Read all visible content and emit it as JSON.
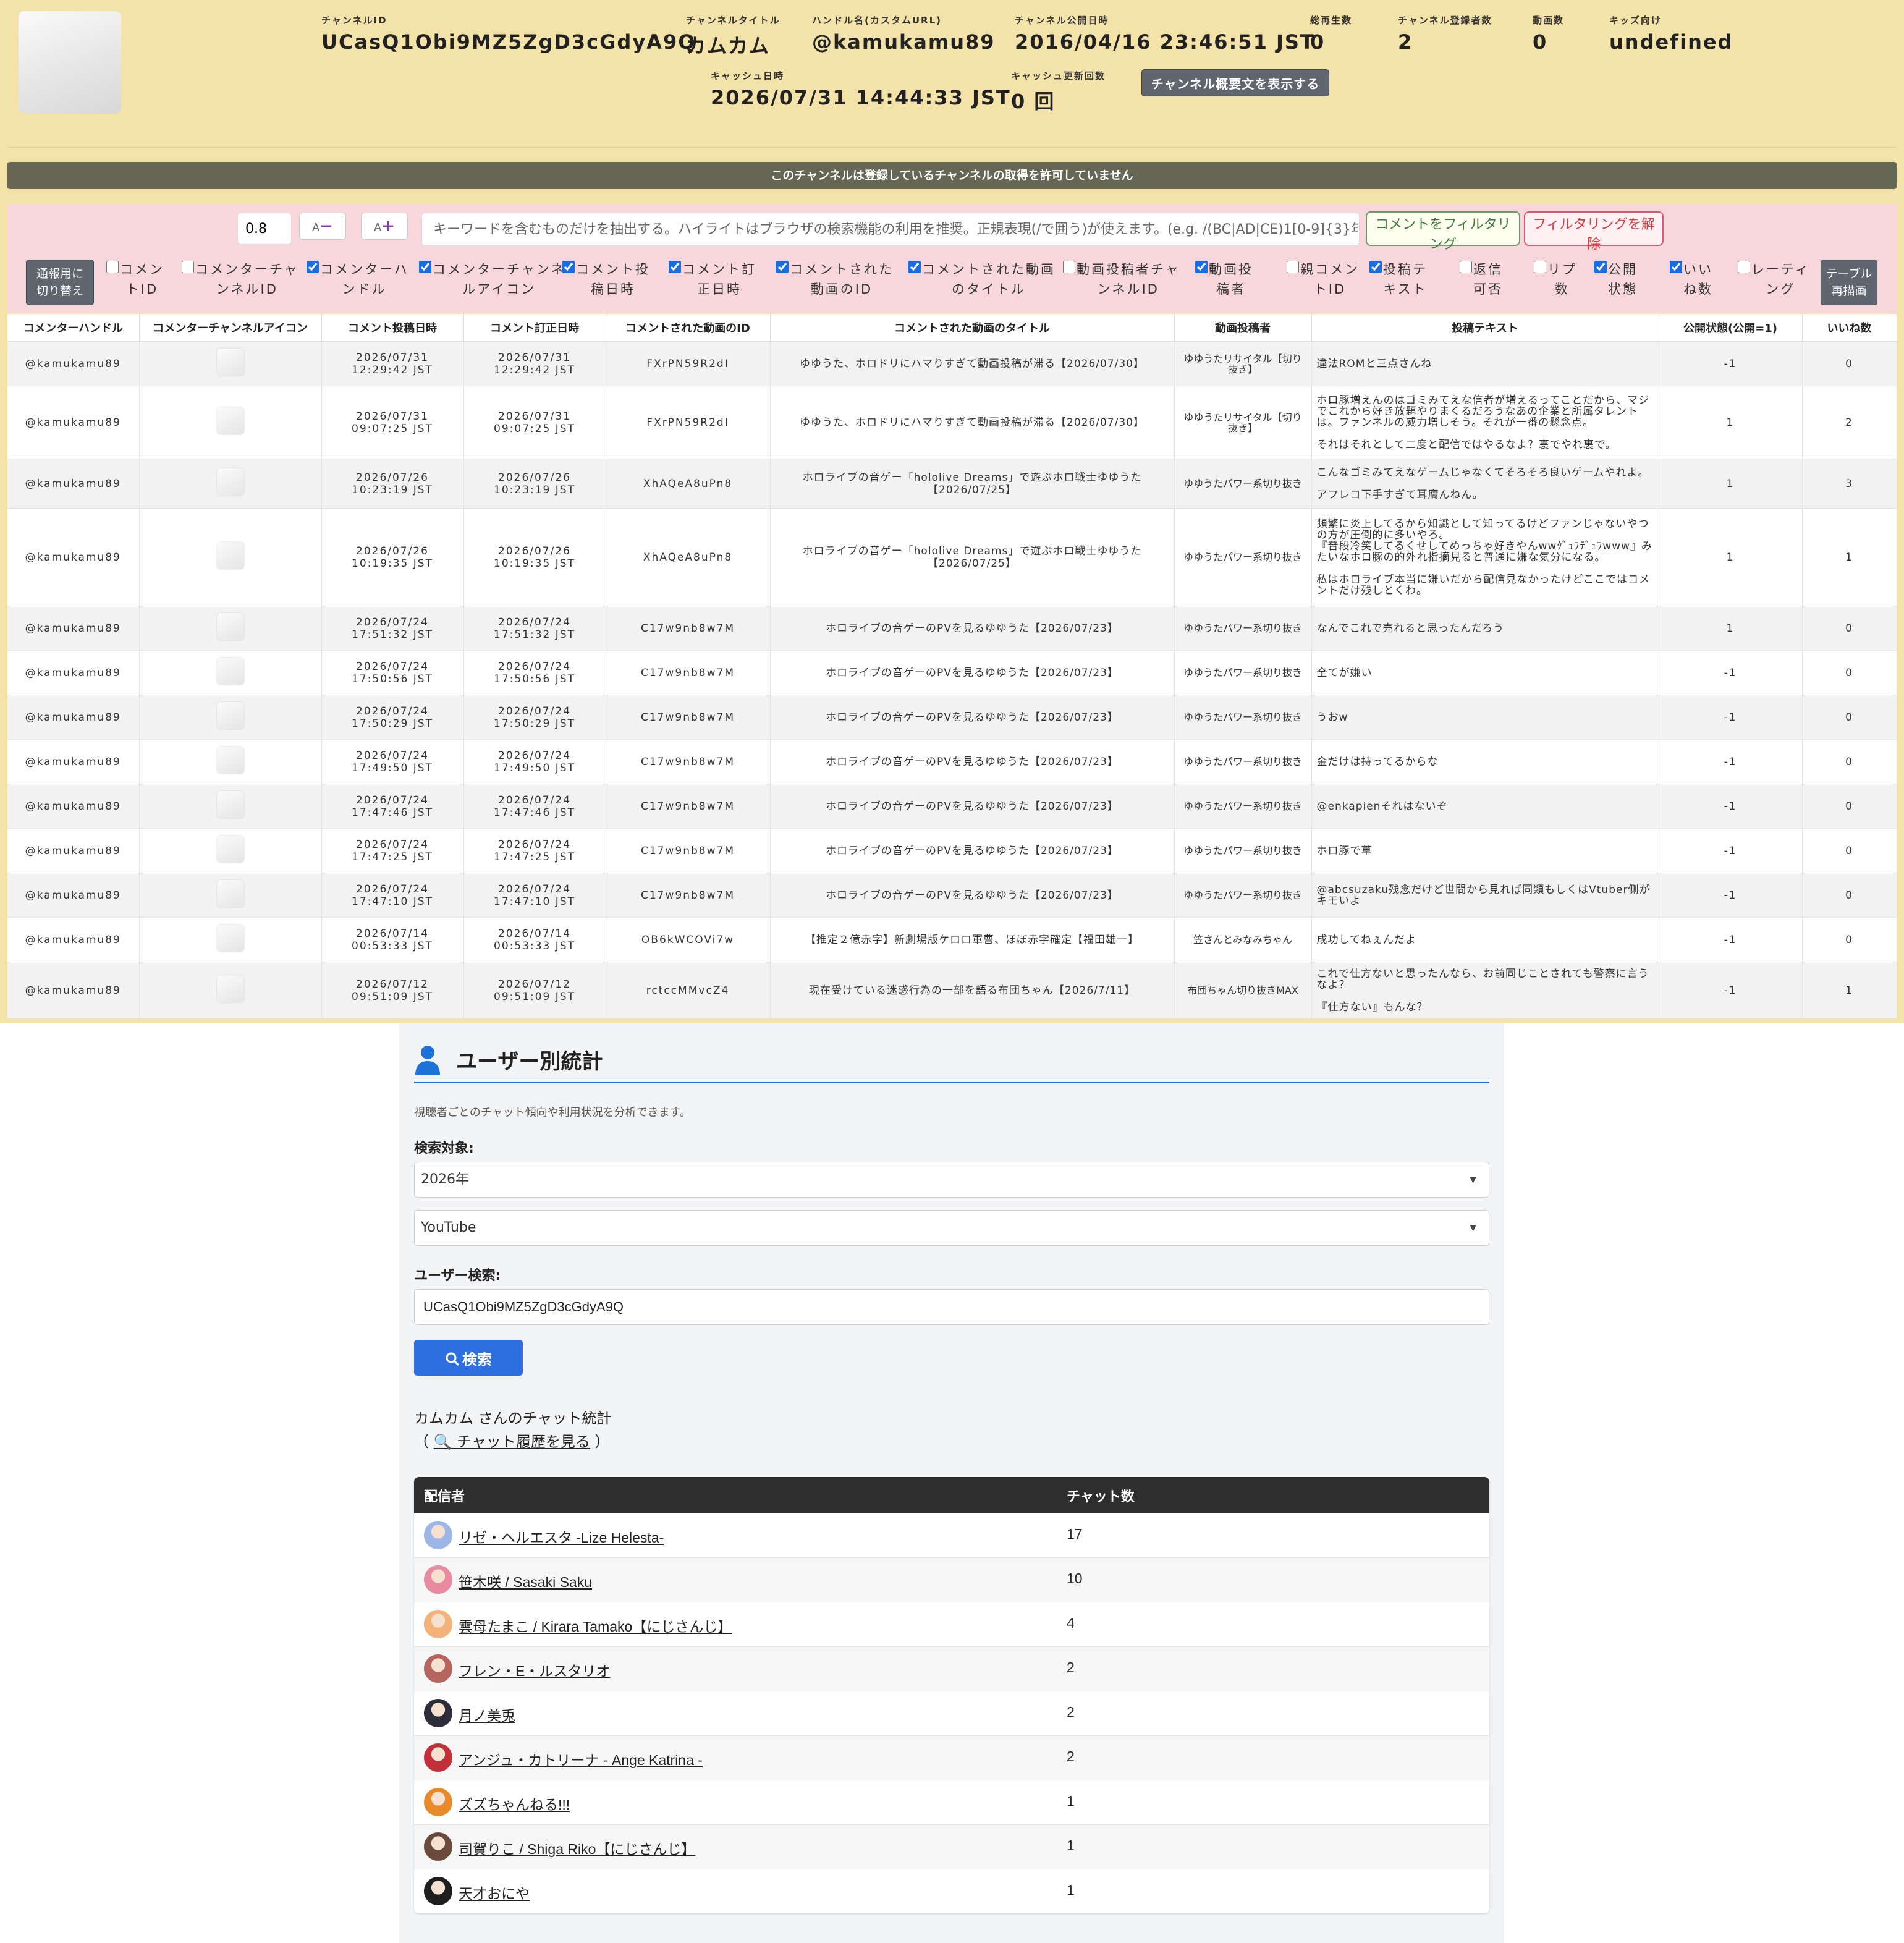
{
  "header": {
    "fields": [
      {
        "label": "チャンネルID",
        "value": "UCasQ1Obi9MZ5ZgD3cGdyA9Q"
      },
      {
        "label": "チャンネルタイトル",
        "value": "カムカム"
      },
      {
        "label": "ハンドル名(カスタムURL)",
        "value": "@kamukamu89"
      },
      {
        "label": "チャンネル公開日時",
        "value": "2016/04/16 23:46:51 JST"
      },
      {
        "label": "総再生数",
        "value": "0"
      },
      {
        "label": "チャンネル登録者数",
        "value": "2"
      },
      {
        "label": "動画数",
        "value": "0"
      },
      {
        "label": "キッズ向け",
        "value": "undefined"
      },
      {
        "label": "キャッシュ日時",
        "value": "2026/07/31 14:44:33 JST"
      },
      {
        "label": "キャッシュ更新回数",
        "value": "0 回"
      }
    ],
    "desc_button": "チャンネル概要文を表示する"
  },
  "banner": "このチャンネルは登録しているチャンネルの取得を許可していません",
  "filter": {
    "font_scale": "0.8",
    "decrease_label": "A",
    "increase_label": "A",
    "keyword_placeholder": "キーワードを含むものだけを抽出する。ハイライトはブラウザの検索機能の利用を推奨。正規表現(/で囲う)が使えます。(e.g. /(BC|AD|CE)1[0-9]{3}年生まれ/i )",
    "apply_label": "コメントをフィルタリング",
    "clear_label": "フィルタリングを解除",
    "switch_label": "通報用に\n切り替え",
    "redraw_label": "テーブル\n再描画",
    "columns": [
      {
        "label": "コメン\nトID",
        "checked": false
      },
      {
        "label": "コメンターチャ\nンネルID",
        "checked": false
      },
      {
        "label": "コメンターハ\nンドル",
        "checked": true
      },
      {
        "label": "コメンターチャンネ\nルアイコン",
        "checked": true
      },
      {
        "label": "コメント投\n稿日時",
        "checked": true
      },
      {
        "label": "コメント訂\n正日時",
        "checked": true
      },
      {
        "label": "コメントされた\n動画のID",
        "checked": true
      },
      {
        "label": "コメントされた動画\nのタイトル",
        "checked": true
      },
      {
        "label": "動画投稿者チャ\nンネルID",
        "checked": false
      },
      {
        "label": "動画投\n稿者",
        "checked": true
      },
      {
        "label": "親コメン\nトID",
        "checked": false
      },
      {
        "label": "投稿テ\nキスト",
        "checked": true
      },
      {
        "label": "返信\n可否",
        "checked": false
      },
      {
        "label": "リプ\n数",
        "checked": false
      },
      {
        "label": "公開\n状態",
        "checked": true
      },
      {
        "label": "いい\nね数",
        "checked": true
      },
      {
        "label": "レーティ\nング",
        "checked": false
      }
    ]
  },
  "table": {
    "headers": [
      "コメンターハンドル",
      "コメンターチャンネルアイコン",
      "コメント投稿日時",
      "コメント訂正日時",
      "コメントされた動画のID",
      "コメントされた動画のタイトル",
      "動画投稿者",
      "投稿テキスト",
      "公開状態(公開=1)",
      "いいね数"
    ],
    "rows": [
      {
        "handle": "@kamukamu89",
        "posted": "2026/07/31\n12:29:42 JST",
        "edited": "2026/07/31\n12:29:42 JST",
        "video_id": "FXrPN59R2dI",
        "title": "ゆゆうた、ホロドリにハマりすぎて動画投稿が滞る【2026/07/30】",
        "uploader": "ゆゆうたリサイタル【切り抜き】",
        "text": "違法ROMと三点さんね",
        "public": "-1",
        "likes": "0"
      },
      {
        "handle": "@kamukamu89",
        "posted": "2026/07/31\n09:07:25 JST",
        "edited": "2026/07/31\n09:07:25 JST",
        "video_id": "FXrPN59R2dI",
        "title": "ゆゆうた、ホロドリにハマりすぎて動画投稿が滞る【2026/07/30】",
        "uploader": "ゆゆうたリサイタル【切り抜き】",
        "text": "ホロ豚増えんのはゴミみてえな信者が増えるってことだから、マジでこれから好き放題やりまくるだろうなあの企業と所属タレントは。ファンネルの威力増しそう。それが一番の懸念点。\n\nそれはそれとして二度と配信ではやるなよ？裏でやれ裏で。",
        "public": "1",
        "likes": "2"
      },
      {
        "handle": "@kamukamu89",
        "posted": "2026/07/26\n10:23:19 JST",
        "edited": "2026/07/26\n10:23:19 JST",
        "video_id": "XhAQeA8uPn8",
        "title": "ホロライブの音ゲー「hololive Dreams」で遊ぶホロ戦士ゆゆうた【2026/07/25】",
        "uploader": "ゆゆうたパワー系切り抜き",
        "text": "こんなゴミみてえなゲームじゃなくてそろそろ良いゲームやれよ。\n\nアフレコ下手すぎて耳腐んねん。",
        "public": "1",
        "likes": "3"
      },
      {
        "handle": "@kamukamu89",
        "posted": "2026/07/26\n10:19:35 JST",
        "edited": "2026/07/26\n10:19:35 JST",
        "video_id": "XhAQeA8uPn8",
        "title": "ホロライブの音ゲー「hololive Dreams」で遊ぶホロ戦士ゆゆうた【2026/07/25】",
        "uploader": "ゆゆうたパワー系切り抜き",
        "text": "頻繁に炎上してるから知識として知ってるけどファンじゃないやつの方が圧倒的に多いやろ。\n『普段冷笑してるくせしてめっちゃ好きやんwwｸﾞｭﾌﾃﾞｭﾌwww』みたいなホロ豚の的外れ指摘見ると普通に嫌な気分になる。\n\n私はホロライブ本当に嫌いだから配信見なかったけどここではコメントだけ残しとくわ。",
        "public": "1",
        "likes": "1"
      },
      {
        "handle": "@kamukamu89",
        "posted": "2026/07/24\n17:51:32 JST",
        "edited": "2026/07/24\n17:51:32 JST",
        "video_id": "C17w9nb8w7M",
        "title": "ホロライブの音ゲーのPVを見るゆゆうた【2026/07/23】",
        "uploader": "ゆゆうたパワー系切り抜き",
        "text": "なんでこれで売れると思ったんだろう",
        "public": "1",
        "likes": "0"
      },
      {
        "handle": "@kamukamu89",
        "posted": "2026/07/24\n17:50:56 JST",
        "edited": "2026/07/24\n17:50:56 JST",
        "video_id": "C17w9nb8w7M",
        "title": "ホロライブの音ゲーのPVを見るゆゆうた【2026/07/23】",
        "uploader": "ゆゆうたパワー系切り抜き",
        "text": "全てが嫌い",
        "public": "-1",
        "likes": "0"
      },
      {
        "handle": "@kamukamu89",
        "posted": "2026/07/24\n17:50:29 JST",
        "edited": "2026/07/24\n17:50:29 JST",
        "video_id": "C17w9nb8w7M",
        "title": "ホロライブの音ゲーのPVを見るゆゆうた【2026/07/23】",
        "uploader": "ゆゆうたパワー系切り抜き",
        "text": "うおw",
        "public": "-1",
        "likes": "0"
      },
      {
        "handle": "@kamukamu89",
        "posted": "2026/07/24\n17:49:50 JST",
        "edited": "2026/07/24\n17:49:50 JST",
        "video_id": "C17w9nb8w7M",
        "title": "ホロライブの音ゲーのPVを見るゆゆうた【2026/07/23】",
        "uploader": "ゆゆうたパワー系切り抜き",
        "text": "金だけは持ってるからな",
        "public": "-1",
        "likes": "0"
      },
      {
        "handle": "@kamukamu89",
        "posted": "2026/07/24\n17:47:46 JST",
        "edited": "2026/07/24\n17:47:46 JST",
        "video_id": "C17w9nb8w7M",
        "title": "ホロライブの音ゲーのPVを見るゆゆうた【2026/07/23】",
        "uploader": "ゆゆうたパワー系切り抜き",
        "text": "@enkapienそれはないぞ",
        "public": "-1",
        "likes": "0"
      },
      {
        "handle": "@kamukamu89",
        "posted": "2026/07/24\n17:47:25 JST",
        "edited": "2026/07/24\n17:47:25 JST",
        "video_id": "C17w9nb8w7M",
        "title": "ホロライブの音ゲーのPVを見るゆゆうた【2026/07/23】",
        "uploader": "ゆゆうたパワー系切り抜き",
        "text": "ホロ豚で草",
        "public": "-1",
        "likes": "0"
      },
      {
        "handle": "@kamukamu89",
        "posted": "2026/07/24\n17:47:10 JST",
        "edited": "2026/07/24\n17:47:10 JST",
        "video_id": "C17w9nb8w7M",
        "title": "ホロライブの音ゲーのPVを見るゆゆうた【2026/07/23】",
        "uploader": "ゆゆうたパワー系切り抜き",
        "text": "@abcsuzaku残念だけど世間から見れば同類もしくはVtuber側がキモいよ",
        "public": "-1",
        "likes": "0"
      },
      {
        "handle": "@kamukamu89",
        "posted": "2026/07/14\n00:53:33 JST",
        "edited": "2026/07/14\n00:53:33 JST",
        "video_id": "OB6kWCOVi7w",
        "title": "【推定２億赤字】新劇場版ケロロ軍曹、ほぼ赤字確定【福田雄一】",
        "uploader": "笠さんとみなみちゃん",
        "text": "成功してねぇんだよ",
        "public": "-1",
        "likes": "0"
      },
      {
        "handle": "@kamukamu89",
        "posted": "2026/07/12\n09:51:09 JST",
        "edited": "2026/07/12\n09:51:09 JST",
        "video_id": "rctccMMvcZ4",
        "title": "現在受けている迷惑行為の一部を語る布団ちゃん【2026/7/11】",
        "uploader": "布団ちゃん切り抜きMAX",
        "text": "これで仕方ないと思ったんなら、お前同じことされても警察に言うなよ？\n\n『仕方ない』もんな？",
        "public": "-1",
        "likes": "1"
      }
    ]
  },
  "stats": {
    "title": "ユーザー別統計",
    "description": "視聴者ごとのチャット傾向や利用状況を分析できます。",
    "search_target_label": "検索対象:",
    "year_select": "2026年",
    "platform_select": "YouTube",
    "user_search_label": "ユーザー検索:",
    "user_search_value": "UCasQ1Obi9MZ5ZgD3cGdyA9Q",
    "search_button": "検索",
    "summary_line": "カムカム さんのチャット統計",
    "history_link": "🔍 チャット履歴を見る",
    "table_headers": {
      "streamer": "配信者",
      "count": "チャット数"
    },
    "streamers": [
      {
        "name": "リゼ・ヘルエスタ -Lize Helesta-",
        "count": "17",
        "avatar_color": "#9db6e8"
      },
      {
        "name": "笹木咲 / Sasaki Saku",
        "count": "10",
        "avatar_color": "#e88aa0"
      },
      {
        "name": "雲母たまこ / Kirara Tamako【にじさんじ】",
        "count": "4",
        "avatar_color": "#f2b27a"
      },
      {
        "name": "フレン・E・ルスタリオ",
        "count": "2",
        "avatar_color": "#b5655d"
      },
      {
        "name": "月ノ美兎",
        "count": "2",
        "avatar_color": "#2c2c3a"
      },
      {
        "name": "アンジュ・カトリーナ - Ange Katrina -",
        "count": "2",
        "avatar_color": "#c4303a"
      },
      {
        "name": "ズズちゃんねる!!!",
        "count": "1",
        "avatar_color": "#e88a2a"
      },
      {
        "name": "司賀りこ / Shiga Riko【にじさんじ】",
        "count": "1",
        "avatar_color": "#6a4a3a"
      },
      {
        "name": "天才おにや",
        "count": "1",
        "avatar_color": "#1e1e1e"
      }
    ]
  }
}
